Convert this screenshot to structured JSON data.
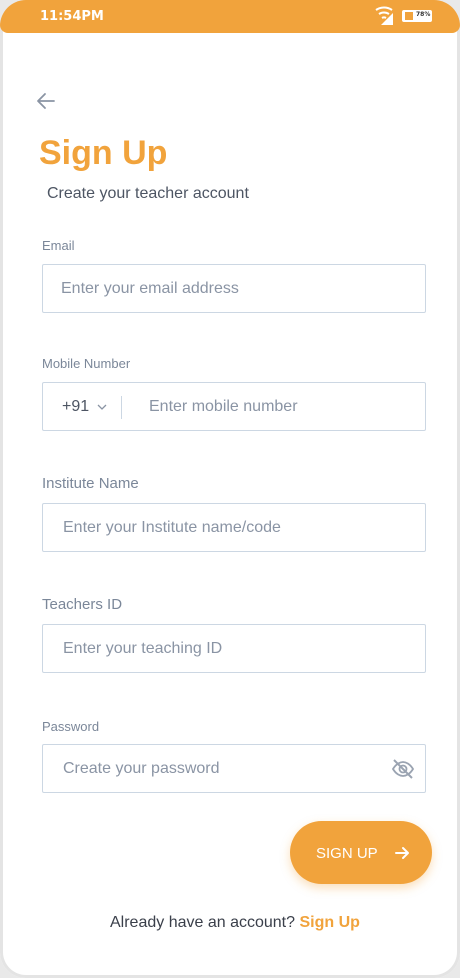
{
  "status_bar": {
    "time": "11:54PM",
    "battery": "78%",
    "signal_icon": "wifi-signal-icon",
    "battery_icon": "battery-icon"
  },
  "header": {
    "back_icon": "arrow-left-icon",
    "title": "Sign Up",
    "subtitle": "Create your teacher account"
  },
  "form": {
    "email": {
      "label": "Email",
      "placeholder": "Enter your email address",
      "value": ""
    },
    "mobile": {
      "label": "Mobile Number",
      "country_code": "+91",
      "placeholder": "Enter mobile number",
      "value": ""
    },
    "institute": {
      "label": "Institute Name",
      "placeholder": "Enter your Institute name/code",
      "value": ""
    },
    "teacher_id": {
      "label": "Teachers ID",
      "placeholder": "Enter your teaching ID",
      "value": ""
    },
    "password": {
      "label": "Password",
      "placeholder": "Create your password",
      "value": "",
      "toggle_icon": "eye-off-icon"
    }
  },
  "submit": {
    "label": "SIGN UP",
    "icon": "arrow-right-icon"
  },
  "footer": {
    "prompt": "Already have an account?",
    "link": "Sign Up"
  },
  "colors": {
    "accent": "#f1a33c",
    "border": "#ccd7e3",
    "label": "#7b8799",
    "text": "#4d5563"
  }
}
